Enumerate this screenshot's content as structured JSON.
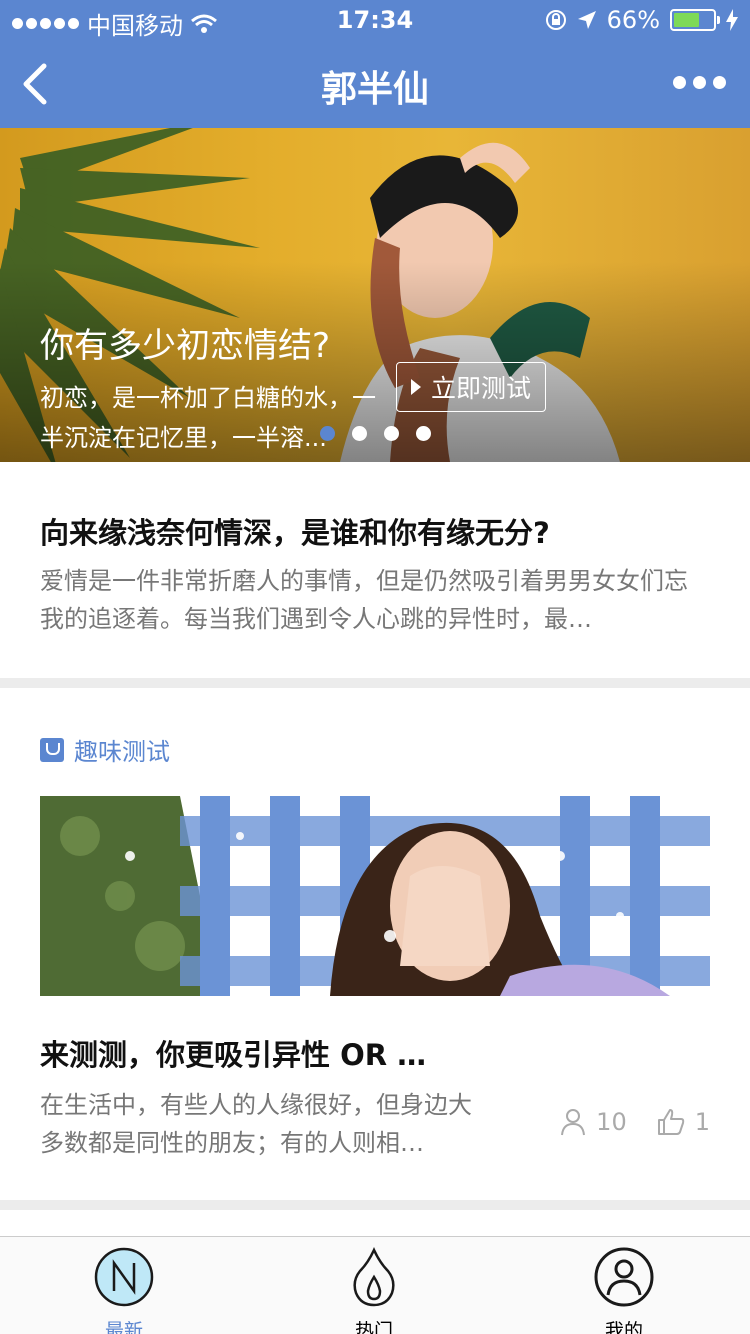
{
  "status_bar": {
    "carrier": "中国移动",
    "time": "17:34",
    "battery": "66%",
    "battery_level": 0.66
  },
  "nav": {
    "title": "郭半仙"
  },
  "banner": {
    "title": "你有多少初恋情结?",
    "text": "初恋，是一杯加了白糖的水，一半沉淀在记忆里，一半溶...",
    "cta_label": "立即测试",
    "dots_count": 4,
    "active_dot": 1
  },
  "article1": {
    "title": "向来缘浅奈何情深，是谁和你有缘无分?",
    "summary": "爱情是一件非常折磨人的事情，但是仍然吸引着男男女女们忘我的追逐着。每当我们遇到令人心跳的异性时，最…"
  },
  "article2": {
    "tag": "趣味测试",
    "title": "来测测，你更吸引异性 OR …",
    "summary": "在生活中，有些人的人缘很好，但身边大多数都是同性的朋友；有的人则相…",
    "views": "10",
    "likes": "1"
  },
  "tabbar": {
    "tabs": [
      {
        "label": "最新",
        "icon": "n-circle-icon",
        "active": true
      },
      {
        "label": "热门",
        "icon": "flame-icon",
        "active": false
      },
      {
        "label": "我的",
        "icon": "user-circle-icon",
        "active": false
      }
    ]
  },
  "colors": {
    "brand": "#5b86d0",
    "banner_bg": "#e3ad2b",
    "battery": "#7ed957"
  }
}
